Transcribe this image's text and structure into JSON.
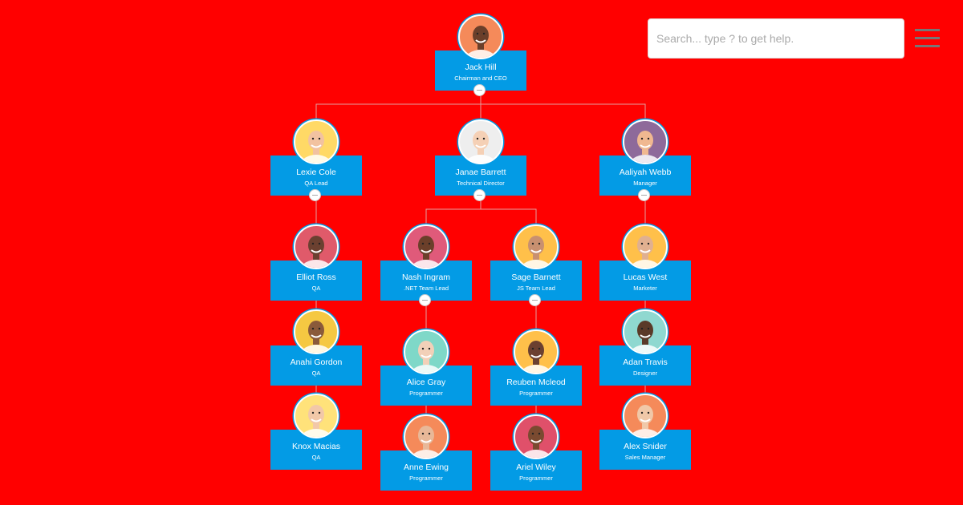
{
  "search": {
    "placeholder": "Search... type ? to get help.",
    "value": ""
  },
  "menu": {
    "icon": "hamburger-menu-icon"
  },
  "colors": {
    "background": "#ff0000",
    "node": "#039be5",
    "connector": "#e0a0a0"
  },
  "nodes": [
    {
      "id": "jack",
      "name": "Jack Hill",
      "title": "Chairman and CEO",
      "parent": null,
      "collapsible": true,
      "avatar_bg": "#f58a5a",
      "skin": "#6b3f2a"
    },
    {
      "id": "lexie",
      "name": "Lexie Cole",
      "title": "QA Lead",
      "parent": "jack",
      "collapsible": true,
      "avatar_bg": "#ffd966",
      "skin": "#f2c2a0"
    },
    {
      "id": "janae",
      "name": "Janae Barrett",
      "title": "Technical Director",
      "parent": "jack",
      "collapsible": true,
      "avatar_bg": "#eeeeee",
      "skin": "#f5d0b5"
    },
    {
      "id": "aaliyah",
      "name": "Aaliyah Webb",
      "title": "Manager",
      "parent": "jack",
      "collapsible": true,
      "avatar_bg": "#8e6a9a",
      "skin": "#f0b890"
    },
    {
      "id": "elliot",
      "name": "Elliot Ross",
      "title": "QA",
      "parent": "lexie",
      "collapsible": false,
      "avatar_bg": "#e05a6a",
      "skin": "#6b4030"
    },
    {
      "id": "anahi",
      "name": "Anahi Gordon",
      "title": "QA",
      "parent": "elliot",
      "collapsible": false,
      "avatar_bg": "#f5c842",
      "skin": "#8a5a3a"
    },
    {
      "id": "knox",
      "name": "Knox Macias",
      "title": "QA",
      "parent": "anahi",
      "collapsible": false,
      "avatar_bg": "#ffe27a",
      "skin": "#f2c8a8"
    },
    {
      "id": "nash",
      "name": "Nash Ingram",
      "title": ".NET Team Lead",
      "parent": "janae",
      "collapsible": true,
      "avatar_bg": "#e05a7a",
      "skin": "#6b3f2a"
    },
    {
      "id": "sage",
      "name": "Sage Barnett",
      "title": "JS Team Lead",
      "parent": "janae",
      "collapsible": true,
      "avatar_bg": "#ffc04a",
      "skin": "#c89070"
    },
    {
      "id": "alice",
      "name": "Alice Gray",
      "title": "Programmer",
      "parent": "nash",
      "collapsible": false,
      "avatar_bg": "#7fd8c8",
      "skin": "#f2d0b8"
    },
    {
      "id": "anne",
      "name": "Anne Ewing",
      "title": "Programmer",
      "parent": "alice",
      "collapsible": false,
      "avatar_bg": "#f58a5a",
      "skin": "#e8b898"
    },
    {
      "id": "reuben",
      "name": "Reuben Mcleod",
      "title": "Programmer",
      "parent": "sage",
      "collapsible": false,
      "avatar_bg": "#ffc04a",
      "skin": "#6b4030"
    },
    {
      "id": "ariel",
      "name": "Ariel Wiley",
      "title": "Programmer",
      "parent": "reuben",
      "collapsible": false,
      "avatar_bg": "#e0506a",
      "skin": "#7a4a30"
    },
    {
      "id": "lucas",
      "name": "Lucas West",
      "title": "Marketer",
      "parent": "aaliyah",
      "collapsible": false,
      "avatar_bg": "#ffc04a",
      "skin": "#e0b090"
    },
    {
      "id": "adan",
      "name": "Adan Travis",
      "title": "Designer",
      "parent": "lucas",
      "collapsible": false,
      "avatar_bg": "#8fd8d0",
      "skin": "#5a3a28"
    },
    {
      "id": "alex",
      "name": "Alex Snider",
      "title": "Sales Manager",
      "parent": "adan",
      "collapsible": false,
      "avatar_bg": "#f58a5a",
      "skin": "#f0c8a8"
    }
  ]
}
